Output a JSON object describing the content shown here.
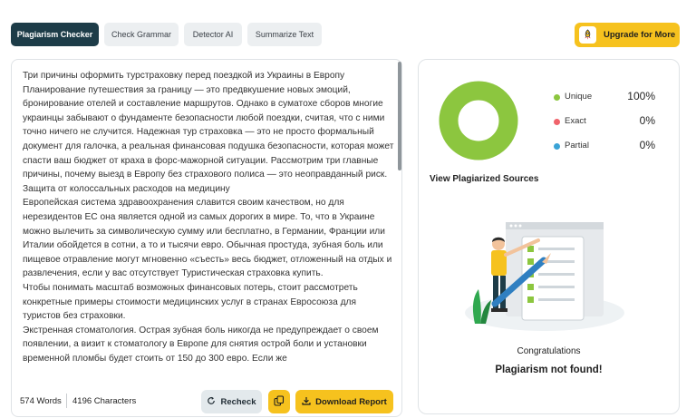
{
  "tabs": [
    {
      "label": "Plagiarism Checker",
      "active": true
    },
    {
      "label": "Check Grammar",
      "active": false
    },
    {
      "label": "Detector AI",
      "active": false
    },
    {
      "label": "Summarize Text",
      "active": false
    }
  ],
  "upgrade": {
    "label": "Upgrade for More",
    "icon": "rocket-icon"
  },
  "editor": {
    "paragraphs": [
      "Три причины оформить турстраховку перед поездкой из Украины в Европу",
      "Планирование путешествия за границу — это предвкушение новых эмоций, бронирование отелей и составление маршрутов. Однако в суматохе сборов многие украинцы забывают о фундаменте безопасности любой поездки, считая, что с ними точно ничего не случится. Надежная тур страховка — это не просто формальный документ для галочка, а реальная финансовая подушка безопасности, которая может спасти ваш бюджет от краха в форс-мажорной ситуации. Рассмотрим три главные причины, почему выезд в Европу без страхового полиса — это неоправданный риск.",
      "Защита от колоссальных расходов на медицину",
      "Европейская система здравоохранения славится своим качеством, но для нерезидентов ЕС она является одной из самых дорогих в мире. То, что в Украине можно вылечить за символическую сумму или бесплатно, в Германии, Франции или Италии обойдется в сотни, а то и тысячи евро. Обычная простуда, зубная боль или пищевое отравление могут мгновенно «съесть» весь бюджет, отложенный на отдых и развлечения, если у вас отсутствует Туристическая страховка купить.",
      "Чтобы понимать масштаб возможных финансовых потерь, стоит рассмотреть конкретные примеры стоимости медицинских услуг в странах Евросоюза для туристов без страховки.",
      "Экстренная стоматология. Острая зубная боль никогда не предупреждает о своем появлении, а визит к стоматологу в Европе для снятия острой боли и установки временной пломбы будет стоить от 150 до 300 евро. Если же"
    ],
    "words": "574 Words",
    "characters": "4196 Characters",
    "recheck_label": "Recheck",
    "download_label": "Download Report"
  },
  "results": {
    "unique_label": "Unique",
    "unique_pct": "100%",
    "exact_label": "Exact",
    "exact_pct": "0%",
    "partial_label": "Partial",
    "partial_pct": "0%",
    "unique_value": 100,
    "colors": {
      "unique": "#8cc63f",
      "exact": "#f0636b",
      "partial": "#3aa3d6"
    },
    "view_sources": "View Plagiarized Sources",
    "congrats": "Congratulations",
    "not_found": "Plagiarism not found!"
  },
  "colors": {
    "accent": "#f6c21e",
    "active_tab": "#1d3c48"
  }
}
